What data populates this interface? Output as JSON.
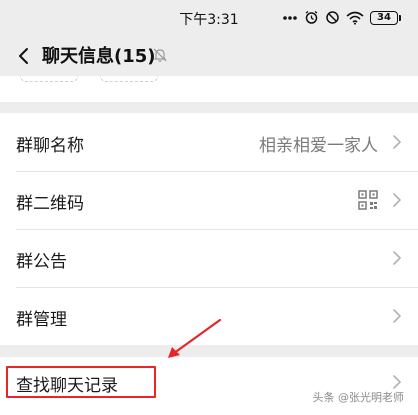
{
  "status_bar": {
    "time": "下午3:31",
    "battery": "34",
    "icons": [
      "dots-icon",
      "alarm-icon",
      "mute-clock-icon",
      "wifi-icon",
      "battery-icon"
    ]
  },
  "nav": {
    "title": "聊天信息(15)",
    "back_icon": "chevron-left-icon",
    "mute_icon": "bell-slash-icon"
  },
  "group_settings": [
    {
      "label": "群聊名称",
      "value": "相亲相爱一家人"
    },
    {
      "label": "群二维码",
      "icon": "qr-code-icon"
    },
    {
      "label": "群公告"
    },
    {
      "label": "群管理"
    }
  ],
  "search_history": {
    "label": "查找聊天记录"
  },
  "annotation": {
    "highlight_color": "#e8262a"
  },
  "watermark": "头条 @张光明老师"
}
